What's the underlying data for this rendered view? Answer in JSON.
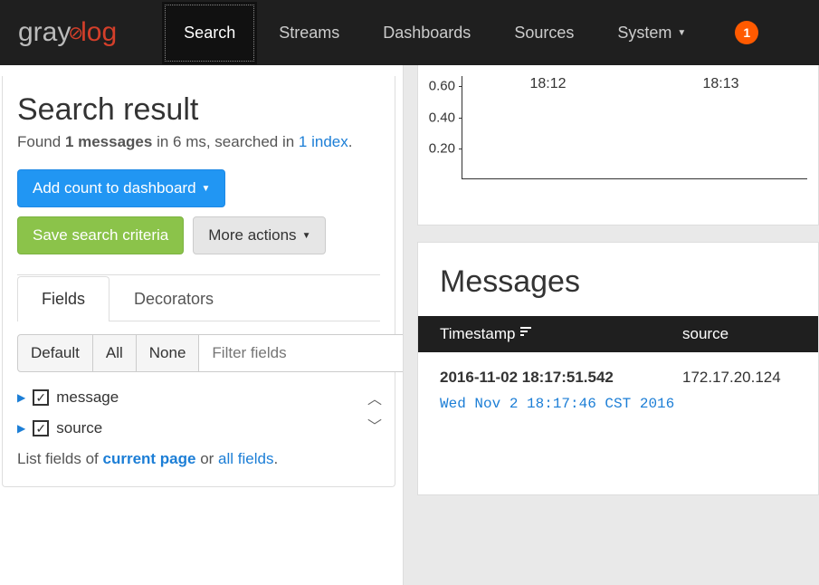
{
  "brand": {
    "part1": "gray",
    "part2": "log"
  },
  "nav": {
    "items": [
      "Search",
      "Streams",
      "Dashboards",
      "Sources",
      "System"
    ],
    "active": "Search",
    "notifications": "1"
  },
  "search_result": {
    "title": "Search result",
    "found_prefix": "Found ",
    "found_count": "1 messages",
    "found_suffix": "  in 6 ms, searched in ",
    "index_link": "1 index",
    "period": "."
  },
  "buttons": {
    "add_dashboard": "Add count to dashboard",
    "save_criteria": "Save search criteria",
    "more_actions": "More actions"
  },
  "tabs": {
    "fields": "Fields",
    "decorators": "Decorators"
  },
  "field_buttons": {
    "default": "Default",
    "all": "All",
    "none": "None"
  },
  "filter_placeholder": "Filter fields",
  "field_items": [
    "message",
    "source"
  ],
  "list_footer": {
    "prefix": "List fields of ",
    "current": "current page",
    "or": " or ",
    "all": "all fields",
    "period": "."
  },
  "chart_data": {
    "type": "bar",
    "y_ticks": [
      "0.60",
      "0.40",
      "0.20"
    ],
    "x_ticks": [
      "18:12",
      "18:13"
    ],
    "categories": [
      "18:12",
      "18:13"
    ],
    "values": [],
    "ylim": [
      0,
      0.7
    ]
  },
  "messages": {
    "title": "Messages",
    "columns": {
      "timestamp": "Timestamp",
      "source": "source"
    },
    "rows": [
      {
        "timestamp": "2016-11-02 18:17:51.542",
        "source": "172.17.20.124",
        "content": "Wed Nov 2 18:17:46 CST 2016"
      }
    ]
  }
}
